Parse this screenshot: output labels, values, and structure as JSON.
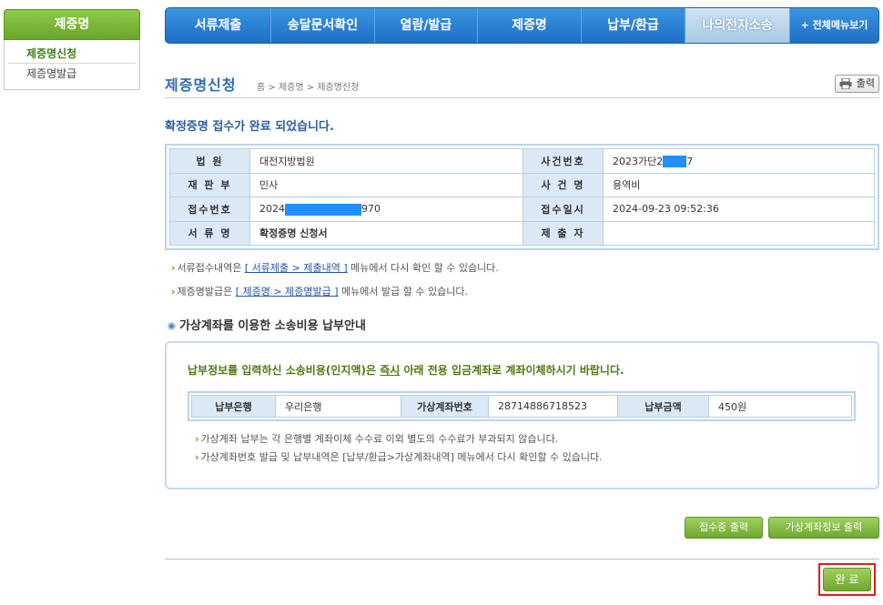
{
  "sidebar": {
    "title": "제증명",
    "items": [
      {
        "label": "제증명신청",
        "active": true
      },
      {
        "label": "제증명발급",
        "active": false
      }
    ]
  },
  "topnav": {
    "items": [
      "서류제출",
      "송달문서확인",
      "열람/발급",
      "제증명",
      "납부/환급",
      "나의전자소송"
    ],
    "all_menu": "+ 전체메뉴보기"
  },
  "page": {
    "title": "제증명신청",
    "breadcrumb": [
      "홈",
      "제증명",
      "제증명신청"
    ],
    "print_label": "출력",
    "complete_message": "확정증명 접수가 완료 되었습니다."
  },
  "info": {
    "court_label": "법 원",
    "court_value": "대전지방법원",
    "case_no_label": "사건번호",
    "case_no_prefix": "2023가단2",
    "case_no_suffix": "7",
    "division_label": "재 판 부",
    "division_value": "민사",
    "case_name_label": "사 건 명",
    "case_name_value": "용역비",
    "receipt_no_label": "접수번호",
    "receipt_no_prefix": "2024",
    "receipt_no_suffix": "970",
    "receipt_dt_label": "접수일시",
    "receipt_dt_value": "2024-09-23 09:52:36",
    "doc_name_label": "서 류 명",
    "doc_name_value": "확정증명 신청서",
    "submitter_label": "제 출 자",
    "submitter_value": ""
  },
  "notes": {
    "n1_pre": "서류접수내역은",
    "n1_link": "[ 서류제출 > 제출내역 ]",
    "n1_post": "메뉴에서 다시 확인 할 수 있습니다.",
    "n2_pre": "제증명발급은",
    "n2_link": "[ 제증명 > 제증명발급 ]",
    "n2_post": "메뉴에서 발급 할 수 있습니다."
  },
  "virtual_account": {
    "section_title": "가상계좌를 이용한 소송비용 납부안내",
    "msg_pre": "납부정보를 입력하신 소송비용(인지액)은",
    "msg_emph": "즉시",
    "msg_post": "아래 전용 입금계좌로 계좌이체하시기 바랍니다.",
    "bank_label": "납부은행",
    "bank_value": "우리은행",
    "account_label": "가상계좌번호",
    "account_value": "28714886718523",
    "amount_label": "납부금액",
    "amount_value": "450원",
    "note1": "가상계좌 납부는 각 은행별 계좌이체 수수료 이외 별도의 수수료가 부과되지 않습니다.",
    "note2": "가상계좌번호 발급 및 납부내역은 [납부/환급>가상계좌내역] 메뉴에서 다시 확인할 수 있습니다."
  },
  "buttons": {
    "receipt_print": "접수증 출력",
    "account_print": "가상계좌정보 출력",
    "done": "완 료"
  },
  "colors": {
    "nav_blue": "#2a83d6",
    "sidebar_green": "#7cb93a",
    "button_green": "#86bd45",
    "highlight_red": "#e11c1c",
    "redaction_blue": "#1e90ff"
  }
}
